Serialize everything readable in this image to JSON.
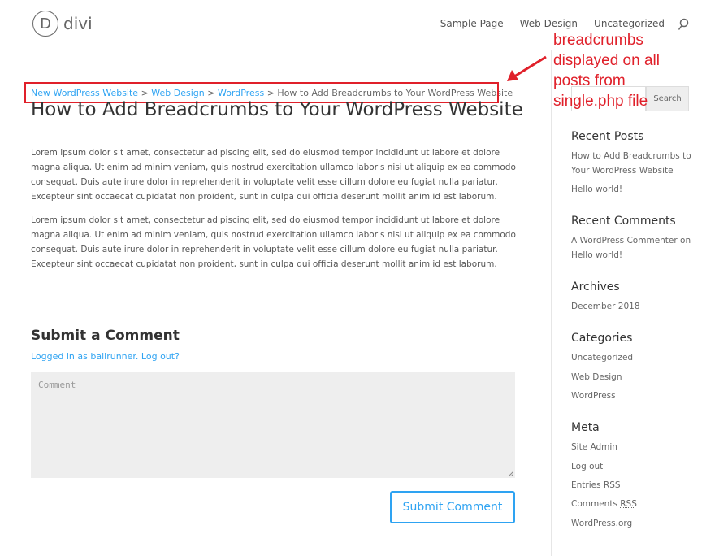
{
  "header": {
    "logo_letter": "D",
    "logo_text": "divi",
    "nav": [
      "Sample Page",
      "Web Design",
      "Uncategorized"
    ]
  },
  "breadcrumb": {
    "items": [
      "New WordPress Website",
      "Web Design",
      "WordPress"
    ],
    "separator": ">",
    "current": "How to Add Breadcrumbs to Your WordPress Website"
  },
  "post": {
    "title": "How to Add Breadcrumbs to Your WordPress Website",
    "paragraphs": [
      "Lorem ipsum dolor sit amet, consectetur adipiscing elit, sed do eiusmod tempor incididunt ut labore et dolore magna aliqua. Ut enim ad minim veniam, quis nostrud exercitation ullamco laboris nisi ut aliquip ex ea commodo consequat. Duis aute irure dolor in reprehenderit in voluptate velit esse cillum dolore eu fugiat nulla pariatur. Excepteur sint occaecat cupidatat non proident, sunt in culpa qui officia deserunt mollit anim id est laborum.",
      "Lorem ipsum dolor sit amet, consectetur adipiscing elit, sed do eiusmod tempor incididunt ut labore et dolore magna aliqua. Ut enim ad minim veniam, quis nostrud exercitation ullamco laboris nisi ut aliquip ex ea commodo consequat. Duis aute irure dolor in reprehenderit in voluptate velit esse cillum dolore eu fugiat nulla pariatur. Excepteur sint occaecat cupidatat non proident, sunt in culpa qui officia deserunt mollit anim id est laborum."
    ]
  },
  "comments": {
    "heading": "Submit a Comment",
    "logged_in_text": "Logged in as ballrunner.",
    "logout_text": "Log out?",
    "placeholder": "Comment",
    "submit_label": "Submit Comment"
  },
  "sidebar": {
    "search_button": "Search",
    "recent_posts_title": "Recent Posts",
    "recent_posts": [
      "How to Add Breadcrumbs to Your WordPress Website",
      "Hello world!"
    ],
    "recent_comments_title": "Recent Comments",
    "recent_comment_author": "A WordPress Commenter",
    "recent_comment_on": "on",
    "recent_comment_post": "Hello world!",
    "archives_title": "Archives",
    "archives": [
      "December 2018"
    ],
    "categories_title": "Categories",
    "categories": [
      "Uncategorized",
      "Web Design",
      "WordPress"
    ],
    "meta_title": "Meta",
    "meta_site_admin": "Site Admin",
    "meta_log_out": "Log out",
    "meta_entries": "Entries",
    "meta_comments": "Comments",
    "meta_rss": "RSS",
    "meta_wordpress_org": "WordPress.org"
  },
  "annotation": {
    "lines": [
      "breadcrumbs",
      "displayed on all",
      "posts from",
      "single.php file"
    ],
    "color": "#e0202a"
  },
  "colors": {
    "link": "#2ea3f2",
    "highlight": "#e0202a"
  }
}
